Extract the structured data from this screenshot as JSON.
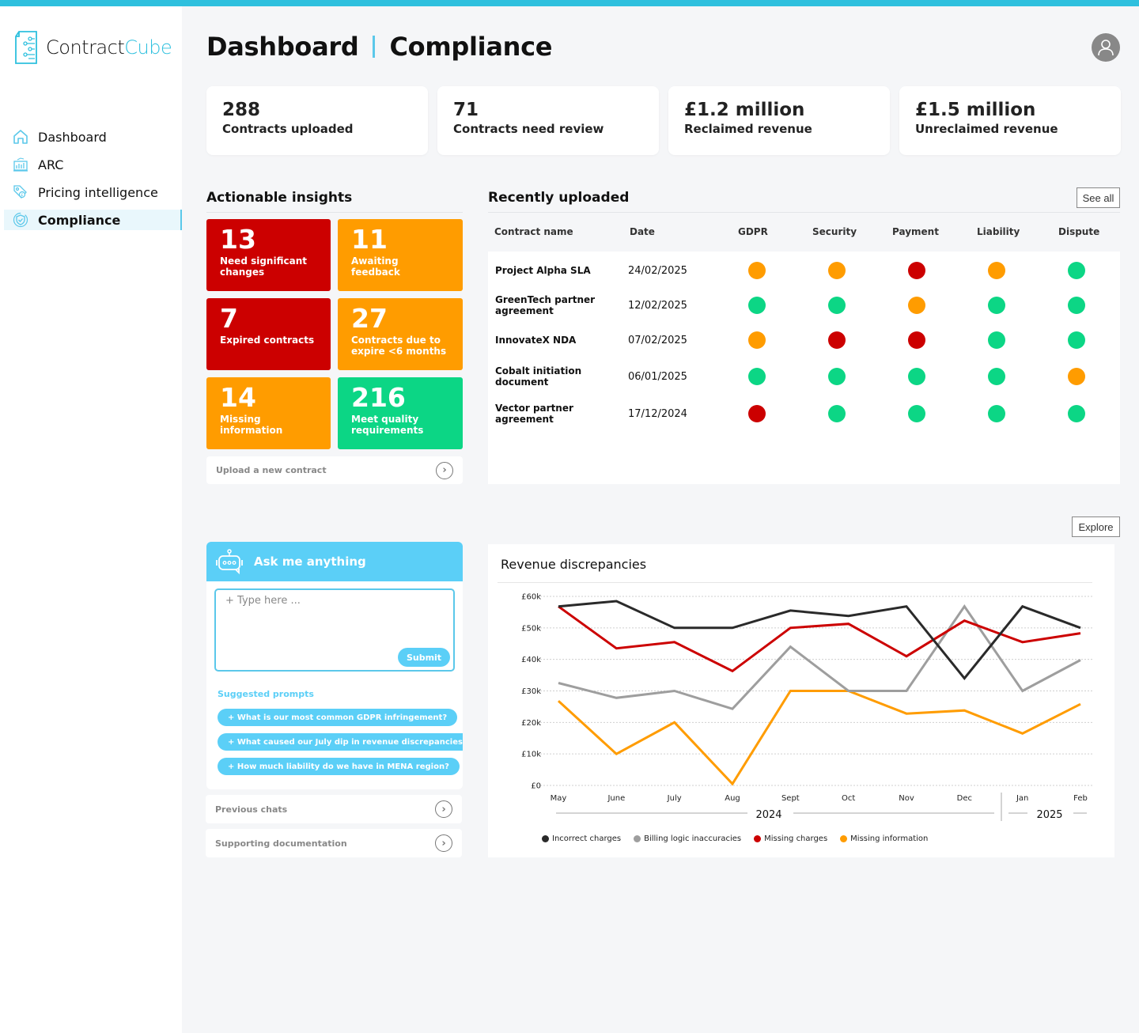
{
  "brand": {
    "name_part1": "Contract",
    "name_part2": "Cube"
  },
  "sidebar": {
    "items": [
      {
        "label": "Dashboard",
        "icon": "home-icon",
        "active": false
      },
      {
        "label": "ARC",
        "icon": "chart-icon",
        "active": false
      },
      {
        "label": "Pricing intelligence",
        "icon": "price-tag-icon",
        "active": false
      },
      {
        "label": "Compliance",
        "icon": "shield-icon",
        "active": true
      }
    ]
  },
  "header": {
    "title": "Dashboard",
    "subtitle": "Compliance",
    "avatar_icon": "user-icon"
  },
  "kpis": [
    {
      "value": "288",
      "label": "Contracts uploaded"
    },
    {
      "value": "71",
      "label": "Contracts need review"
    },
    {
      "value": "£1.2 million",
      "label": "Reclaimed revenue"
    },
    {
      "value": "£1.5 million",
      "label": "Unreclaimed revenue"
    }
  ],
  "insights": {
    "title": "Actionable insights",
    "tiles": [
      {
        "value": "13",
        "label": "Need significant changes",
        "status": "red"
      },
      {
        "value": "11",
        "label": "Awaiting feedback",
        "status": "orange"
      },
      {
        "value": "7",
        "label": "Expired contracts",
        "status": "red"
      },
      {
        "value": "27",
        "label": "Contracts due to expire <6 months",
        "status": "orange"
      },
      {
        "value": "14",
        "label": "Missing information",
        "status": "orange"
      },
      {
        "value": "216",
        "label": "Meet quality requirements",
        "status": "green"
      }
    ],
    "upload_label": "Upload a new contract"
  },
  "recent": {
    "title": "Recently uploaded",
    "see_all": "See all",
    "columns": [
      "Contract name",
      "Date",
      "GDPR",
      "Security",
      "Payment",
      "Liability",
      "Dispute"
    ],
    "rows": [
      {
        "name": "Project Alpha SLA",
        "date": "24/02/2025",
        "statuses": [
          "orange",
          "orange",
          "red",
          "orange",
          "green"
        ]
      },
      {
        "name": "GreenTech partner agreement",
        "date": "12/02/2025",
        "statuses": [
          "green",
          "green",
          "orange",
          "green",
          "green"
        ]
      },
      {
        "name": "InnovateX NDA",
        "date": "07/02/2025",
        "statuses": [
          "orange",
          "red",
          "red",
          "green",
          "green"
        ]
      },
      {
        "name": "Cobalt initiation document",
        "date": "06/01/2025",
        "statuses": [
          "green",
          "green",
          "green",
          "green",
          "orange"
        ]
      },
      {
        "name": "Vector partner agreement",
        "date": "17/12/2024",
        "statuses": [
          "red",
          "green",
          "green",
          "green",
          "green"
        ]
      }
    ]
  },
  "status_colors": {
    "red": "#cc0000",
    "orange": "#ff9c00",
    "green": "#0cd685"
  },
  "chat": {
    "title": "Ask me anything",
    "icon": "chatbot-icon",
    "placeholder": "+ Type here ...",
    "submit": "Submit",
    "suggested_title": "Suggested prompts",
    "prompts": [
      "+ What is our most common GDPR infringement?",
      "+ What caused our July dip in revenue discrepancies?",
      "+ How much liability do we have in MENA region?"
    ],
    "previous_chats": "Previous chats",
    "supporting_docs": "Supporting documentation"
  },
  "explore_label": "Explore",
  "chart_data": {
    "type": "line",
    "title": "Revenue discrepancies",
    "categories": [
      "May",
      "June",
      "July",
      "Aug",
      "Sept",
      "Oct",
      "Nov",
      "Dec",
      "Jan",
      "Feb"
    ],
    "year_groups": [
      {
        "label": "2024",
        "months": [
          "May",
          "June",
          "July",
          "Aug",
          "Sept",
          "Oct",
          "Nov",
          "Dec"
        ]
      },
      {
        "label": "2025",
        "months": [
          "Jan",
          "Feb"
        ]
      }
    ],
    "ylim": [
      0,
      60000
    ],
    "yticks": [
      0,
      10000,
      20000,
      30000,
      40000,
      50000,
      60000
    ],
    "ytick_labels": [
      "£0",
      "£10k",
      "£20k",
      "£30k",
      "£40k",
      "£50k",
      "£60k"
    ],
    "grid": true,
    "legend_position": "bottom",
    "series": [
      {
        "name": "Incorrect charges",
        "color": "#2a2a2a",
        "values": [
          56800,
          58500,
          50000,
          50000,
          55500,
          53800,
          56800,
          34000,
          56800,
          50000
        ]
      },
      {
        "name": "Billing logic inaccuracies",
        "color": "#9e9e9e",
        "values": [
          32500,
          27800,
          30000,
          24300,
          44000,
          30000,
          30000,
          56800,
          30000,
          39800
        ]
      },
      {
        "name": "Missing charges",
        "color": "#cc0000",
        "values": [
          56800,
          43500,
          45500,
          36300,
          50000,
          51300,
          41000,
          52300,
          45500,
          48300
        ]
      },
      {
        "name": "Missing information",
        "color": "#ff9c00",
        "values": [
          26800,
          10000,
          20000,
          500,
          30000,
          30000,
          22800,
          23800,
          16500,
          25800
        ]
      }
    ]
  }
}
